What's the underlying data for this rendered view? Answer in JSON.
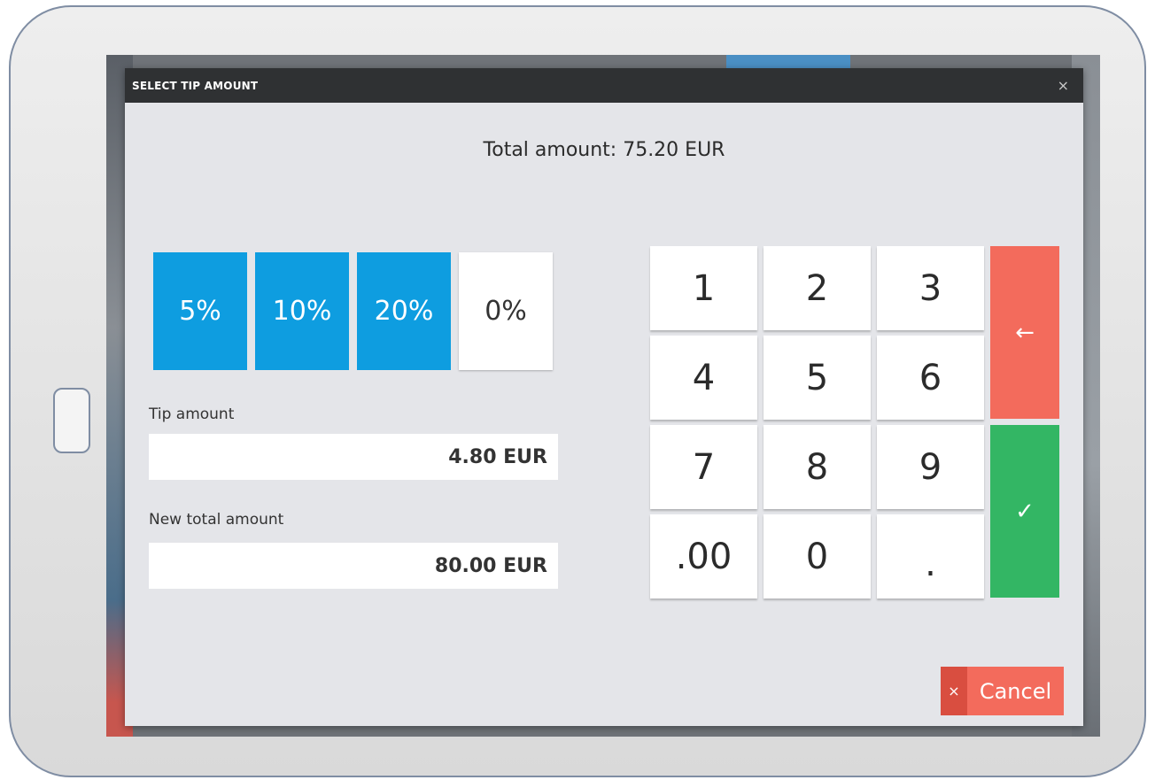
{
  "dialog": {
    "title": "SELECT TIP AMOUNT",
    "close_glyph": "×"
  },
  "total": {
    "text": "Total amount: 75.20 EUR"
  },
  "tip_options": [
    {
      "label": "5%",
      "selected": true
    },
    {
      "label": "10%",
      "selected": true
    },
    {
      "label": "20%",
      "selected": true
    },
    {
      "label": "0%",
      "selected": false
    }
  ],
  "tip_amount": {
    "label": "Tip amount",
    "value": "4.80 EUR"
  },
  "new_total": {
    "label": "New total amount",
    "value": "80.00 EUR"
  },
  "keypad": {
    "keys": [
      "1",
      "2",
      "3",
      "4",
      "5",
      "6",
      "7",
      "8",
      "9",
      ".00",
      "0",
      "."
    ],
    "backspace_icon": "arrow-left-icon",
    "backspace_glyph": "←",
    "confirm_icon": "check-icon",
    "confirm_glyph": "✓"
  },
  "cancel": {
    "icon_glyph": "×",
    "label": "Cancel"
  },
  "colors": {
    "accent_blue": "#0e9de0",
    "danger_red": "#f36b5c",
    "success_green": "#33b664",
    "header_dark": "#2f3133",
    "dialog_bg": "#e4e5e9"
  }
}
